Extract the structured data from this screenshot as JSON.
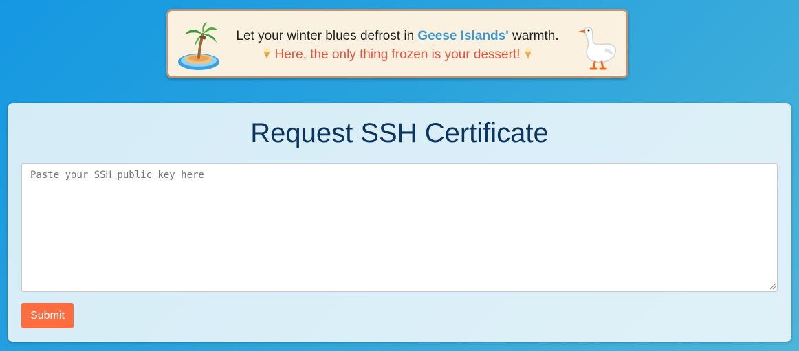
{
  "banner": {
    "line1_prefix": "Let your winter blues defrost in ",
    "line1_highlight": "Geese Islands'",
    "line1_suffix": " warmth.",
    "line2": "Here, the only thing frozen is your dessert!",
    "left_icon": "palm-island-icon",
    "right_icon": "goose-icon",
    "dessert_icon": "ice-cream-icon"
  },
  "card": {
    "title": "Request SSH Certificate",
    "textarea_placeholder": "Paste your SSH public key here",
    "textarea_value": "",
    "submit_label": "Submit"
  },
  "colors": {
    "accent_button": "#fe6d3f",
    "highlight_text": "#3f97cb",
    "tagline_text": "#e9543f",
    "title_text": "#0c3461"
  }
}
